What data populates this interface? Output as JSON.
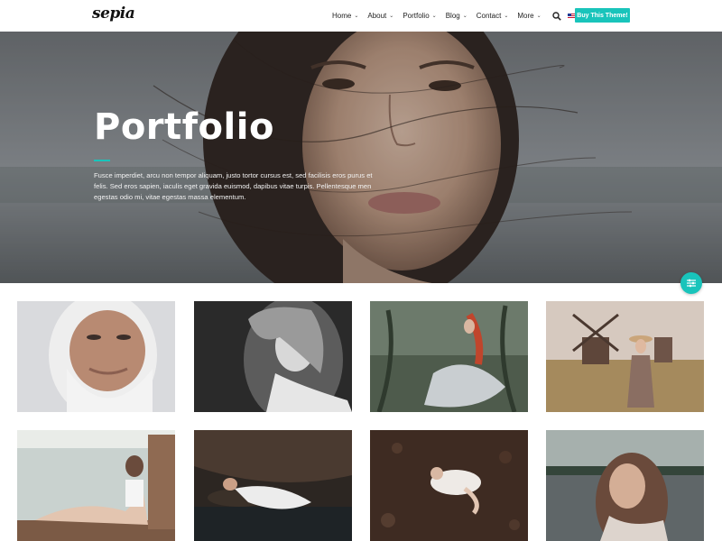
{
  "header": {
    "logo": "sepia",
    "nav": [
      {
        "label": "Home",
        "has_dropdown": true
      },
      {
        "label": "About",
        "has_dropdown": true
      },
      {
        "label": "Portfolio",
        "has_dropdown": true
      },
      {
        "label": "Blog",
        "has_dropdown": true
      },
      {
        "label": "Contact",
        "has_dropdown": true
      },
      {
        "label": "More",
        "has_dropdown": true
      }
    ],
    "search_icon": "search-icon",
    "language": "EN",
    "buy_label": "Buy This Theme!"
  },
  "hero": {
    "title": "Portfolio",
    "text": "Fusce imperdiet, arcu non tempor aliquam, justo tortor cursus est, sed facilisis eros purus et felis. Sed eros sapien, iaculis eget gravida euismod, dapibus vitae turpis. Pellentesque men egestas odio mi, vitae egestas massa elementum."
  },
  "filter_button_icon": "sliders-icon",
  "colors": {
    "accent": "#19c4bb"
  },
  "gallery": [
    {
      "subject": "old-man-portrait"
    },
    {
      "subject": "woman-bw-portrait"
    },
    {
      "subject": "red-hair-woman-forest"
    },
    {
      "subject": "woman-windmill-field"
    },
    {
      "subject": "woman-sitting-lake"
    },
    {
      "subject": "woman-lying-water"
    },
    {
      "subject": "woman-curled-leaves"
    },
    {
      "subject": "woman-portrait-lake"
    }
  ]
}
